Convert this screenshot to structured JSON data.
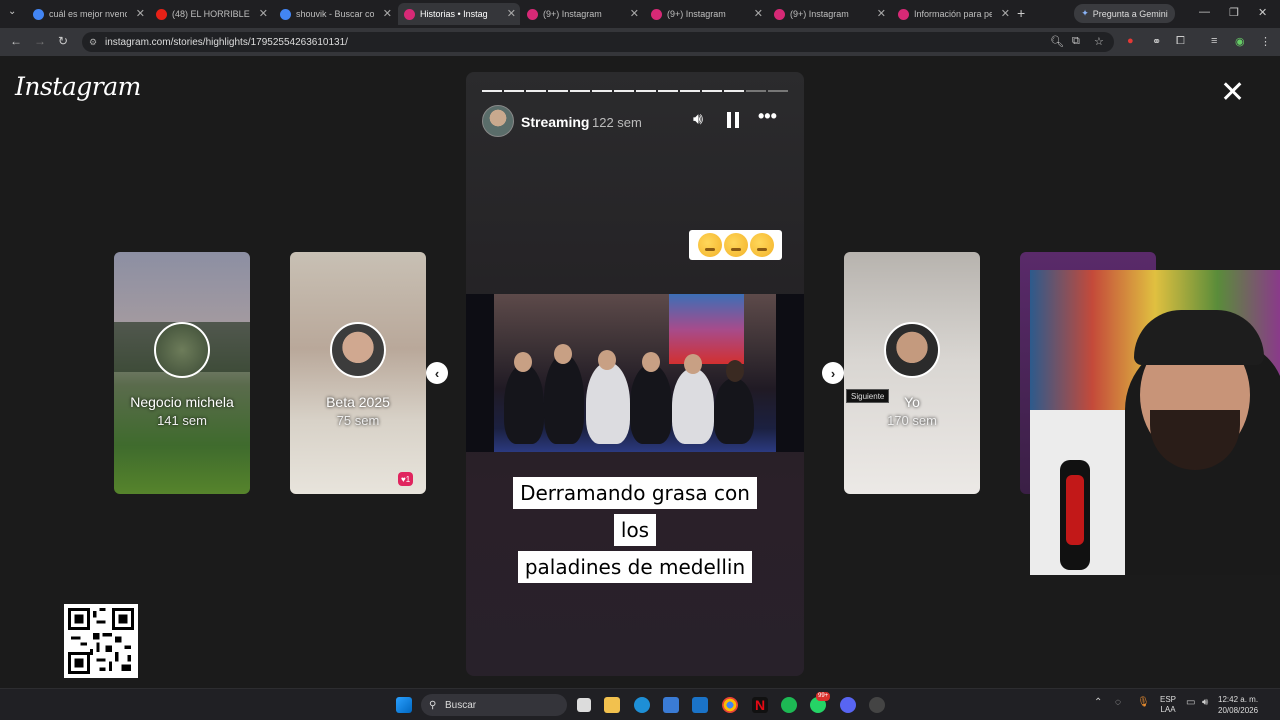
{
  "browser": {
    "tabs": [
      {
        "title": "cuál es mejor nvenc I",
        "color": "#4285f4"
      },
      {
        "title": "(48) EL HORRIBLE FIN",
        "color": "#e62117"
      },
      {
        "title": "shouvik - Buscar con",
        "color": "#4285f4"
      },
      {
        "title": "Historias • Instag",
        "color": "#d62976"
      },
      {
        "title": "(9+) Instagram",
        "color": "#d62976"
      },
      {
        "title": "(9+) Instagram",
        "color": "#d62976"
      },
      {
        "title": "(9+) Instagram",
        "color": "#d62976"
      },
      {
        "title": "Información para per",
        "color": "#d62976"
      }
    ],
    "new_tab": "+",
    "gemini_label": "Pregunta a Gemini",
    "url": "instagram.com/stories/highlights/17952554263610131/"
  },
  "instagram": {
    "logo": "Instagram",
    "close_icon": "✕",
    "story": {
      "username": "Streaming",
      "time": "122 sem",
      "progress_total": 14,
      "progress_done": 12,
      "caption_line1": "Derramando grasa con los",
      "caption_line2": "paladines de medellin"
    },
    "side_stories": [
      {
        "label": "Negocio michela",
        "sub": "141 sem"
      },
      {
        "label": "Beta 2025",
        "sub": "75 sem"
      },
      {
        "label": "Yo",
        "sub": "170 sem"
      }
    ],
    "tooltip": "Siguiente",
    "heart_badge": "1"
  },
  "taskbar": {
    "search_placeholder": "Buscar",
    "lang_top": "ESP",
    "lang_bottom": "LAA",
    "time": "12:42 a. m.",
    "date": "20/08/2026",
    "spotify_badge": "99+"
  }
}
